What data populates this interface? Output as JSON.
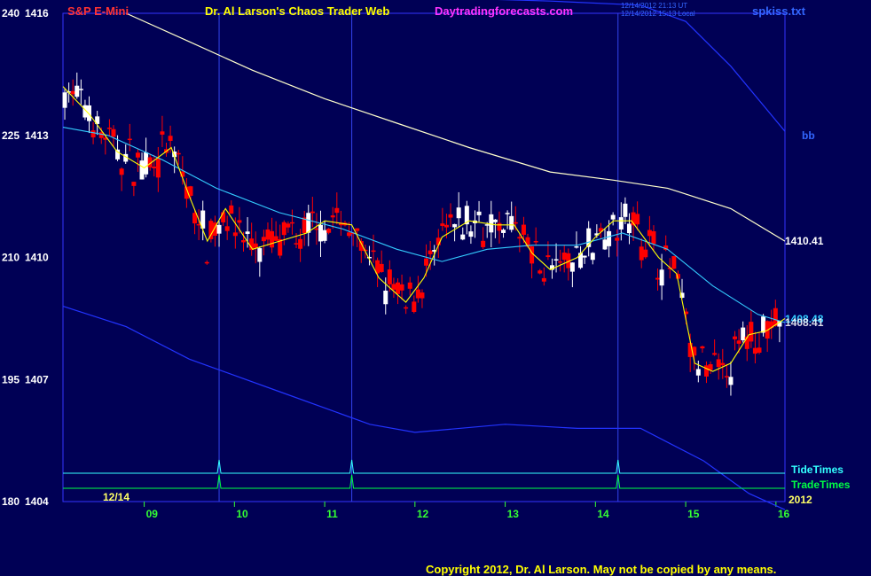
{
  "header": {
    "instrument": "S&P E-Mini",
    "title": "Dr. Al Larson's Chaos Trader Web",
    "site": "Daytradingforecasts.com",
    "timestamp_ut": "12/14/2012 21:13 UT",
    "timestamp_local": "12/14/2012 15:13 Local",
    "file": "spkiss.txt"
  },
  "colors": {
    "background": "#000055",
    "frame": "#3333ff",
    "instrument": "#ff3333",
    "title": "#ffff00",
    "site": "#ff33ff",
    "up_bar": "#ffffff",
    "down_bar": "#ff0000",
    "ema_fast": "#ffff00",
    "ema_mid": "#33ccff",
    "ema_slow": "#ffffcc",
    "envelope": "#2233ff",
    "tide": "#33ffff",
    "trade": "#00ff44",
    "axis_text": "#ffffff",
    "time_text": "#33ff33",
    "copyright": "#ffff00"
  },
  "chart_data": {
    "type": "candlestick",
    "date_label": "12/14",
    "y_ticks": [
      {
        "osc": "240",
        "price": "1416"
      },
      {
        "osc": "225",
        "price": "1413"
      },
      {
        "osc": "210",
        "price": "1410"
      },
      {
        "osc": "195",
        "price": "1407"
      },
      {
        "osc": "180",
        "price": "1404"
      }
    ],
    "ylim": [
      1404,
      1416
    ],
    "x_ticks": [
      "09",
      "10",
      "11",
      "12",
      "13",
      "14",
      "15",
      "16"
    ],
    "x_tick_hours": [
      9,
      10,
      11,
      12,
      13,
      14,
      15,
      16
    ],
    "xlim": [
      8.1,
      16.1
    ],
    "vertical_markers": [
      9.83,
      11.3,
      14.25
    ],
    "right_labels": {
      "top_label": "bb",
      "slow_value": "1410.41",
      "price_value": "1408.48",
      "mid_value": "1408.41",
      "tide": "TideTimes",
      "trade": "TradeTimes",
      "year": "2012"
    },
    "ema_slow": [
      [
        8.8,
        1416.0
      ],
      [
        9.5,
        1415.3
      ],
      [
        10.2,
        1414.6
      ],
      [
        11.0,
        1413.9
      ],
      [
        11.8,
        1413.3
      ],
      [
        12.6,
        1412.7
      ],
      [
        13.5,
        1412.1
      ],
      [
        14.2,
        1411.9
      ],
      [
        14.8,
        1411.7
      ],
      [
        15.5,
        1411.2
      ],
      [
        16.1,
        1410.4
      ]
    ],
    "ema_mid": [
      [
        8.1,
        1413.2
      ],
      [
        8.6,
        1413.0
      ],
      [
        9.2,
        1412.4
      ],
      [
        9.8,
        1411.7
      ],
      [
        10.5,
        1411.1
      ],
      [
        11.2,
        1410.7
      ],
      [
        11.8,
        1410.2
      ],
      [
        12.3,
        1409.9
      ],
      [
        12.8,
        1410.2
      ],
      [
        13.3,
        1410.3
      ],
      [
        13.8,
        1410.3
      ],
      [
        14.3,
        1410.6
      ],
      [
        14.8,
        1410.2
      ],
      [
        15.3,
        1409.3
      ],
      [
        15.8,
        1408.6
      ],
      [
        16.1,
        1408.4
      ]
    ],
    "ema_fast": [
      [
        8.1,
        1414.2
      ],
      [
        8.4,
        1413.5
      ],
      [
        8.7,
        1412.6
      ],
      [
        9.0,
        1412.2
      ],
      [
        9.3,
        1412.7
      ],
      [
        9.5,
        1411.5
      ],
      [
        9.7,
        1410.4
      ],
      [
        9.9,
        1411.2
      ],
      [
        10.2,
        1410.2
      ],
      [
        10.5,
        1410.4
      ],
      [
        10.8,
        1410.6
      ],
      [
        11.0,
        1410.9
      ],
      [
        11.3,
        1410.8
      ],
      [
        11.6,
        1409.5
      ],
      [
        11.9,
        1408.9
      ],
      [
        12.1,
        1409.5
      ],
      [
        12.3,
        1410.5
      ],
      [
        12.6,
        1410.9
      ],
      [
        12.9,
        1410.8
      ],
      [
        13.1,
        1410.8
      ],
      [
        13.3,
        1410.1
      ],
      [
        13.5,
        1409.7
      ],
      [
        13.8,
        1410.0
      ],
      [
        14.0,
        1410.5
      ],
      [
        14.2,
        1410.9
      ],
      [
        14.4,
        1410.9
      ],
      [
        14.7,
        1410.0
      ],
      [
        14.9,
        1409.6
      ],
      [
        15.1,
        1407.4
      ],
      [
        15.3,
        1407.2
      ],
      [
        15.5,
        1407.4
      ],
      [
        15.7,
        1408.1
      ],
      [
        15.9,
        1408.2
      ],
      [
        16.1,
        1408.5
      ]
    ],
    "env_upper": [
      [
        8.2,
        1417.2
      ],
      [
        9.0,
        1416.8
      ],
      [
        10.5,
        1416.5
      ],
      [
        12.0,
        1416.4
      ],
      [
        13.5,
        1416.3
      ],
      [
        14.5,
        1416.2
      ],
      [
        15.0,
        1415.8
      ],
      [
        15.5,
        1414.7
      ],
      [
        16.1,
        1413.1
      ]
    ],
    "env_lower": [
      [
        8.1,
        1408.8
      ],
      [
        8.8,
        1408.3
      ],
      [
        9.5,
        1407.5
      ],
      [
        10.5,
        1406.7
      ],
      [
        11.5,
        1405.9
      ],
      [
        12.0,
        1405.7
      ],
      [
        13.0,
        1405.9
      ],
      [
        13.8,
        1405.8
      ],
      [
        14.5,
        1405.8
      ],
      [
        15.2,
        1405.0
      ],
      [
        15.7,
        1404.2
      ],
      [
        16.1,
        1403.8
      ]
    ]
  },
  "footer": {
    "copyright": "Copyright 2012, Dr. Al Larson. May not be copied by any means."
  }
}
